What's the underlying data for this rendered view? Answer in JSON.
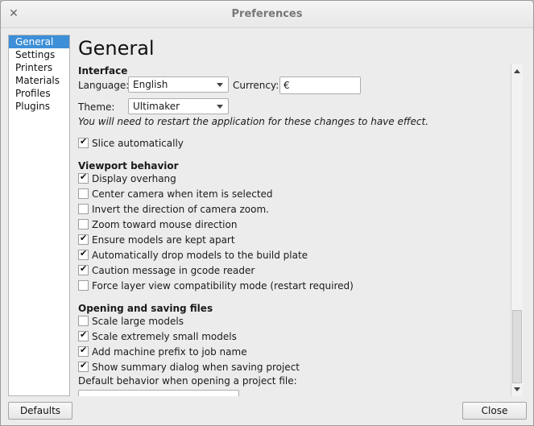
{
  "window": {
    "title": "Preferences"
  },
  "sidebar": {
    "items": [
      "General",
      "Settings",
      "Printers",
      "Materials",
      "Profiles",
      "Plugins"
    ]
  },
  "page": {
    "heading": "General"
  },
  "interface": {
    "section": "Interface",
    "language_label": "Language:",
    "language_value": "English",
    "currency_label": "Currency:",
    "currency_value": "€",
    "theme_label": "Theme:",
    "theme_value": "Ultimaker",
    "restart_note": "You will need to restart the application for these changes to have effect."
  },
  "slicing": {
    "label": "Slice automatically",
    "checked": true
  },
  "viewport": {
    "section": "Viewport behavior",
    "options": [
      {
        "label": "Display overhang",
        "checked": true
      },
      {
        "label": "Center camera when item is selected",
        "checked": false
      },
      {
        "label": "Invert the direction of camera zoom.",
        "checked": false
      },
      {
        "label": "Zoom toward mouse direction",
        "checked": false
      },
      {
        "label": "Ensure models are kept apart",
        "checked": true
      },
      {
        "label": "Automatically drop models to the build plate",
        "checked": true
      },
      {
        "label": "Caution message in gcode reader",
        "checked": true
      },
      {
        "label": "Force layer view compatibility mode (restart required)",
        "checked": false
      }
    ]
  },
  "files": {
    "section": "Opening and saving files",
    "options": [
      {
        "label": "Scale large models",
        "checked": false
      },
      {
        "label": "Scale extremely small models",
        "checked": true
      },
      {
        "label": "Add machine prefix to job name",
        "checked": true
      },
      {
        "label": "Show summary dialog when saving project",
        "checked": true
      }
    ],
    "project_behavior_label": "Default behavior when opening a project file:"
  },
  "buttons": {
    "defaults": "Defaults",
    "close": "Close"
  }
}
